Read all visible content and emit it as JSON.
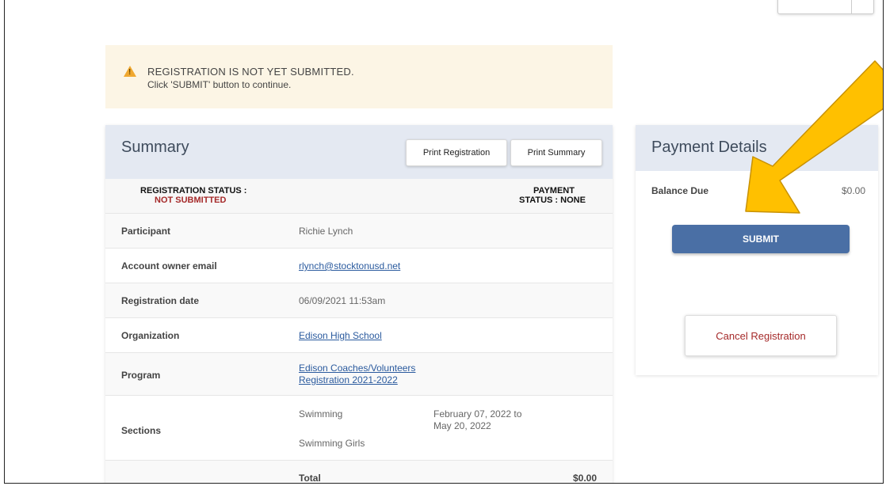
{
  "alert": {
    "line1": "REGISTRATION IS NOT YET SUBMITTED.",
    "line2": "Click 'SUBMIT' button to continue.",
    "icon": "warning-icon"
  },
  "summary": {
    "title": "Summary",
    "print_registration": "Print Registration",
    "print_summary": "Print Summary",
    "registration_status_label": "REGISTRATION STATUS :",
    "registration_status_value": "NOT SUBMITTED",
    "payment_status_line1": "PAYMENT",
    "payment_status_line2": "STATUS : NONE",
    "rows": {
      "participant": {
        "label": "Participant",
        "value": "Richie Lynch"
      },
      "email": {
        "label": "Account owner email",
        "value": "rlynch@stocktonusd.net"
      },
      "date": {
        "label": "Registration date",
        "value": "06/09/2021 11:53am"
      },
      "organization": {
        "label": "Organization",
        "value": "Edison High School"
      },
      "program": {
        "label": "Program",
        "value_line1": "Edison Coaches/Volunteers",
        "value_line2": "Registration 2021-2022"
      },
      "sections": {
        "label": "Sections",
        "section1": "Swimming",
        "section2": "Swimming Girls",
        "dates_line1": "February 07, 2022 to",
        "dates_line2": "May 20, 2022"
      },
      "total": {
        "label": "Total",
        "value": "$0.00"
      }
    }
  },
  "payment": {
    "title": "Payment Details",
    "balance_label": "Balance Due",
    "balance_value": "$0.00",
    "submit_label": "SUBMIT",
    "cancel_label": "Cancel Registration"
  },
  "colors": {
    "accent": "#4a6fa5",
    "danger": "#a52a2a",
    "annotation_arrow": "#ffc000"
  }
}
